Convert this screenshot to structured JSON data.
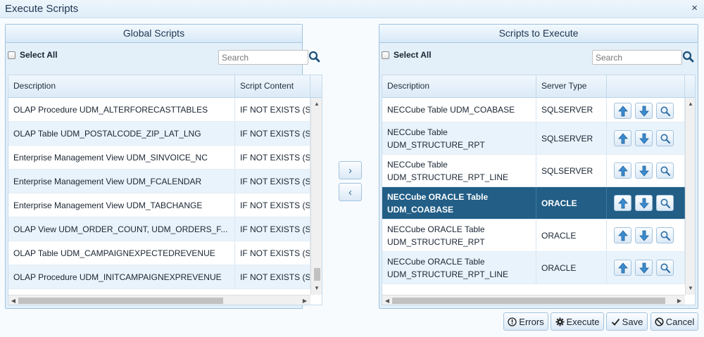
{
  "dialog": {
    "title": "Execute Scripts",
    "close": "×"
  },
  "global": {
    "header": "Global Scripts",
    "select_all": "Select All",
    "search_placeholder": "Search",
    "columns": [
      "Description",
      "Script Content"
    ],
    "rows": [
      {
        "description": "OLAP Procedure UDM_ALTERFORECASTTABLES",
        "content": "IF NOT EXISTS (S"
      },
      {
        "description": "OLAP Table UDM_POSTALCODE_ZIP_LAT_LNG",
        "content": "IF NOT EXISTS (S"
      },
      {
        "description": "Enterprise Management View UDM_SINVOICE_NC",
        "content": "IF NOT EXISTS (S"
      },
      {
        "description": "Enterprise Management View UDM_FCALENDAR",
        "content": "IF NOT EXISTS (S"
      },
      {
        "description": "Enterprise Management View UDM_TABCHANGE",
        "content": "IF NOT EXISTS (S"
      },
      {
        "description": "OLAP View UDM_ORDER_COUNT, UDM_ORDERS_F...",
        "content": "IF NOT EXISTS (S"
      },
      {
        "description": "OLAP Table UDM_CAMPAIGNEXPECTEDREVENUE",
        "content": "IF NOT EXISTS (S"
      },
      {
        "description": "OLAP Procedure UDM_INITCAMPAIGNEXPREVENUE",
        "content": "IF NOT EXISTS (S"
      }
    ]
  },
  "execute": {
    "header": "Scripts to Execute",
    "select_all": "Select All",
    "search_placeholder": "Search",
    "columns": [
      "Description",
      "Server Type"
    ],
    "rows": [
      {
        "line1": "NECCube Table UDM_COABASE",
        "line2": "",
        "server": "SQLSERVER",
        "selected": false
      },
      {
        "line1": "NECCube Table",
        "line2": "UDM_STRUCTURE_RPT",
        "server": "SQLSERVER",
        "selected": false
      },
      {
        "line1": "NECCube Table",
        "line2": "UDM_STRUCTURE_RPT_LINE",
        "server": "SQLSERVER",
        "selected": false
      },
      {
        "line1": "NECCube ORACLE Table",
        "line2": "UDM_COABASE",
        "server": "ORACLE",
        "selected": true
      },
      {
        "line1": "NECCube ORACLE Table",
        "line2": "UDM_STRUCTURE_RPT",
        "server": "ORACLE",
        "selected": false
      },
      {
        "line1": "NECCube ORACLE Table",
        "line2": "UDM_STRUCTURE_RPT_LINE",
        "server": "ORACLE",
        "selected": false
      }
    ]
  },
  "move": {
    "add": "›",
    "remove": "‹"
  },
  "footer": {
    "errors": "Errors",
    "execute": "Execute",
    "save": "Save",
    "cancel": "Cancel"
  },
  "colors": {
    "accent": "#225e86",
    "panel": "#e3eff9",
    "row_alt": "#e9f3fb"
  }
}
